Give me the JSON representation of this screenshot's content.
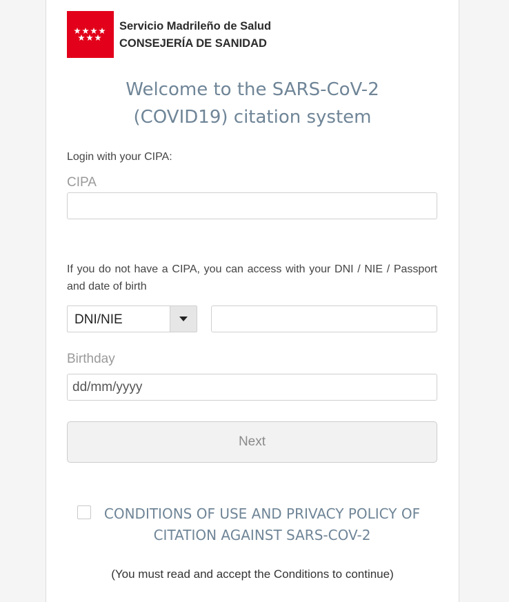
{
  "header": {
    "logo": "comunidad-de-madrid-logo",
    "org_name": "Servicio Madrileño de Salud",
    "org_dept": "CONSEJERÍA DE SANIDAD"
  },
  "welcome": {
    "line1": "Welcome to the SARS-CoV-2",
    "line2": "(COVID19) citation system"
  },
  "cipa_section": {
    "intro": "Login with your CIPA:",
    "field_label": "CIPA",
    "value": ""
  },
  "alt_section": {
    "text": "If you do not have a CIPA, you can access with your DNI / NIE / Passport and date of birth",
    "doc_type_selected": "DNI/NIE",
    "doc_number_value": ""
  },
  "birthday": {
    "field_label": "Birthday",
    "placeholder": "dd/mm/yyyy"
  },
  "next_button": {
    "label": "Next"
  },
  "conditions": {
    "line1": "CONDITIONS OF USE AND PRIVACY POLICY OF",
    "line2": "CITATION AGAINST SARS-COV-2",
    "checked": false,
    "note": "(You must read and accept the Conditions to continue)"
  },
  "colors": {
    "brand_red": "#e2001a",
    "title_blue": "#6f8597"
  }
}
